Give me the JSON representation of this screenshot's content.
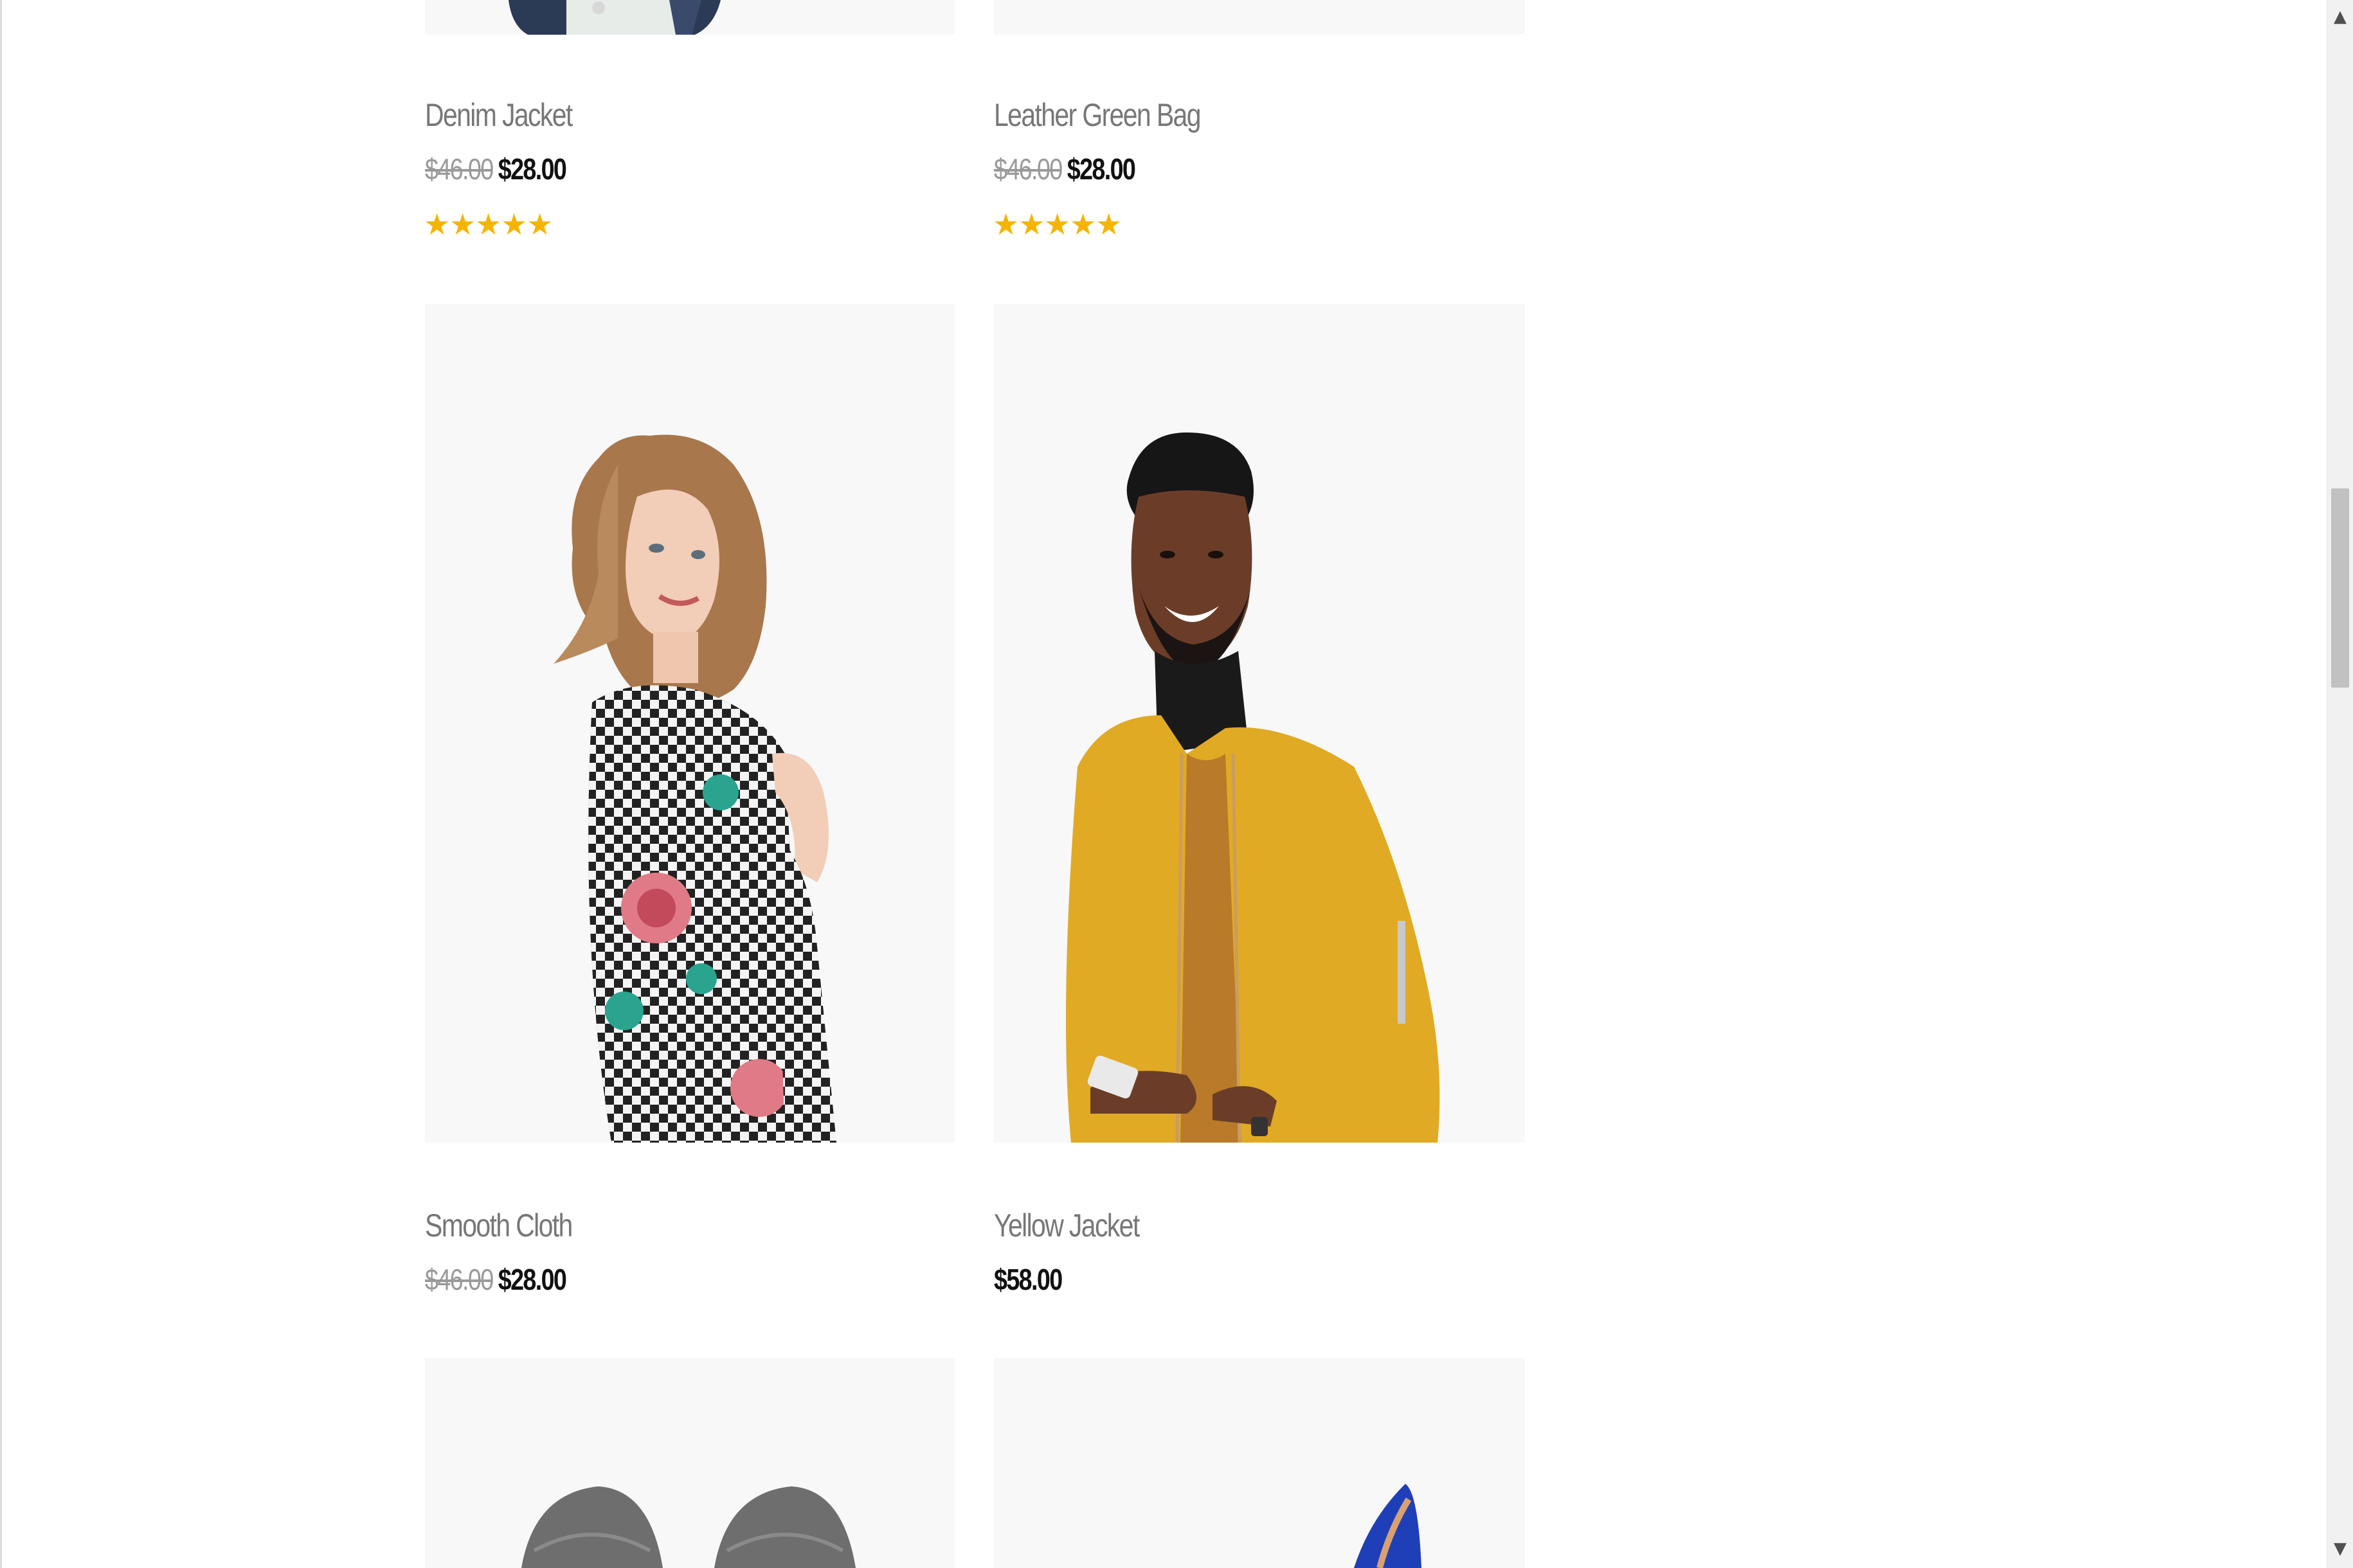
{
  "products": [
    {
      "name": "Denim Jacket",
      "old_price": "$46.00",
      "price": "$28.00",
      "rating": 5,
      "star_icon": "star-icon"
    },
    {
      "name": "Leather Green Bag",
      "old_price": "$46.00",
      "price": "$28.00",
      "rating": 5,
      "star_icon": "star-icon"
    },
    {
      "name": "Smooth Cloth",
      "old_price": "$46.00",
      "price": "$28.00"
    },
    {
      "name": "Yellow Jacket",
      "price": "$58.00"
    }
  ],
  "colors": {
    "star": "#f5b400",
    "name_text": "#777777",
    "price_text": "#111111",
    "old_price_text": "#9a9a9a",
    "image_bg": "#f8f8f8"
  },
  "scrollbar": {
    "up_arrow": "▲",
    "down_arrow": "▼"
  }
}
